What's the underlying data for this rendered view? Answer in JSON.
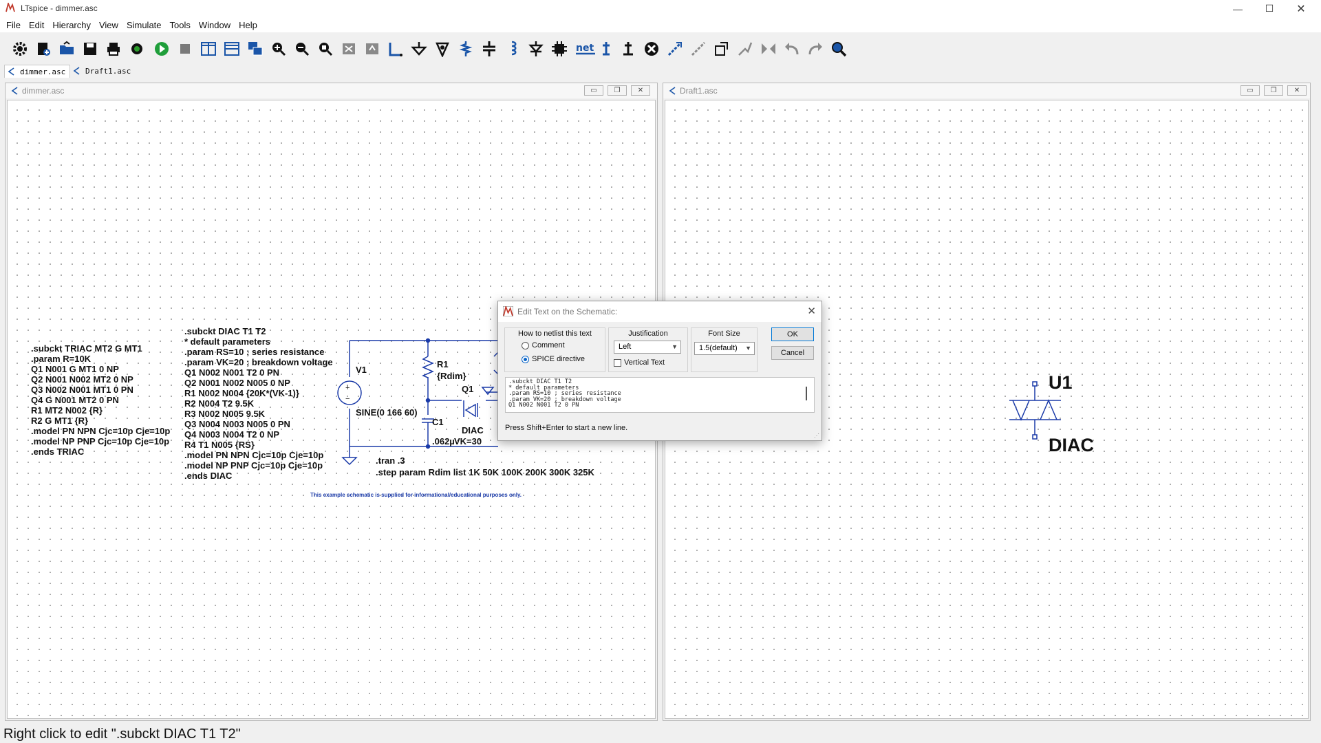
{
  "window": {
    "title": "LTspice - dimmer.asc"
  },
  "menu": [
    "File",
    "Edit",
    "Hierarchy",
    "View",
    "Simulate",
    "Tools",
    "Window",
    "Help"
  ],
  "toolbar": {
    "net_label": "net"
  },
  "tabs": [
    "dimmer.asc",
    "Draft1.asc"
  ],
  "left_window": {
    "title": "dimmer.asc",
    "triac_subckt": ".subckt TRIAC MT2 G MT1\n.param R=10K\nQ1 N001 G MT1 0 NP\nQ2 N001 N002 MT2 0 NP\nQ3 N002 N001 MT1 0 PN\nQ4 G N001 MT2 0 PN\nR1 MT2 N002 {R}\nR2 G MT1 {R}\n.model PN NPN Cjc=10p Cje=10p\n.model NP PNP Cjc=10p Cje=10p\n.ends TRIAC",
    "diac_subckt": ".subckt DIAC T1 T2\n* default parameters\n.param RS=10 ; series resistance\n.param VK=20 ; breakdown voltage\nQ1 N002 N001 T2 0 PN\nQ2 N001 N002 N005 0 NP\nR1 N002 N004 {20K*(VK-1)}\nR2 N004 T2 9.5K\nR3 N002 N005 9.5K\nQ3 N004 N003 N005 0 PN\nQ4 N003 N004 T2 0 NP\nR4 T1 N005 {RS}\n.model PN NPN Cjc=10p Cje=10p\n.model NP PNP Cjc=10p Cje=10p\n.ends DIAC",
    "labels": {
      "v1": "V1",
      "v1_value": "SINE(0 166 60)",
      "r1": "R1",
      "r1_value": "{Rdim}",
      "q1": "Q1",
      "c1": "C1",
      "c1_value": ".062µ",
      "diac": "DIAC",
      "vk": "VK=30",
      "tran": ".tran .3",
      "step": ".step param Rdim list 1K 50K 100K 200K 300K 325K",
      "disclaimer": "This example schematic is supplied for informational/educational purposes only."
    }
  },
  "right_window": {
    "title": "Draft1.asc",
    "component_name": "U1",
    "component_value": "DIAC"
  },
  "dialog": {
    "title": "Edit Text on the Schematic:",
    "netlist_group": "How to netlist this text",
    "option_comment": "Comment",
    "option_spice": "SPICE directive",
    "justification_label": "Justification",
    "justification_value": "Left",
    "vertical_text": "Vertical Text",
    "font_size_label": "Font Size",
    "font_size_value": "1.5(default)",
    "ok": "OK",
    "cancel": "Cancel",
    "text": ".subckt DIAC T1 T2\n* default parameters\n.param RS=10 ; series resistance\n.param VK=20 ; breakdown voltage\nQ1 N002 N001 T2 0 PN",
    "hint": "Press Shift+Enter to start a new line."
  },
  "status": {
    "text": "Right click to edit \".subckt DIAC T1 T2\""
  }
}
